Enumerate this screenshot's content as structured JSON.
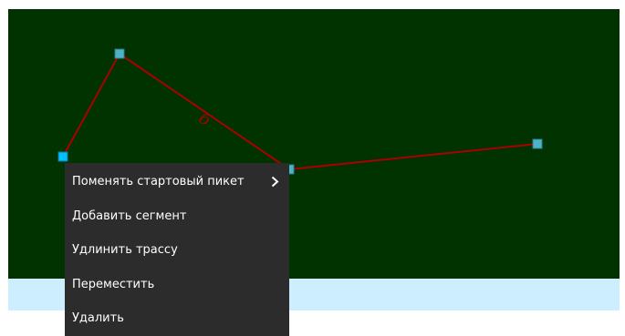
{
  "canvas": {
    "background_color": "#003300",
    "lower_band_color": "#cdeeff",
    "route_color": "#aa0000",
    "vertex_color": "#4fb3c8",
    "selected_vertex_color": "#00bfff",
    "segment_label": "б"
  },
  "context_menu": {
    "items": [
      {
        "label": "Поменять стартовый пикет",
        "icon": "chevron-right-icon"
      },
      {
        "label": "Добавить сегмент"
      },
      {
        "label": "Удлинить трассу"
      },
      {
        "label": "Переместить"
      },
      {
        "label": "Удалить"
      }
    ]
  }
}
